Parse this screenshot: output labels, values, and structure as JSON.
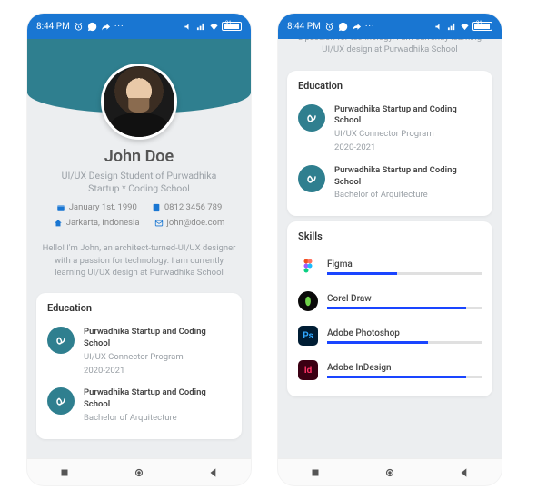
{
  "status": {
    "time": "8:44 PM",
    "icons_left": [
      "alarm-icon",
      "whatsapp-icon",
      "share-icon"
    ],
    "more": "···",
    "icons_right": [
      "voice-icon",
      "signal-icon",
      "wifi-icon"
    ],
    "battery": "91"
  },
  "profile": {
    "name": "John Doe",
    "subtitle": "UI/UX Design Student of Purwadhika Startup * Coding School",
    "birthdate": "January 1st, 1990",
    "phone": "0812 3456 789",
    "location": "Jarkarta, Indonesia",
    "email": "john@doe.com",
    "bio": "Hello! I'm John, an architect-turned-UI/UX designer with a passion for technology. I am currently learning UI/UX design at Purwadhika School",
    "bio_tail": "a passion for technology. I am currently learning UI/UX design at Purwadhika School"
  },
  "education": {
    "title": "Education",
    "items": [
      {
        "school": "Purwadhika Startup and Coding School",
        "program": "UI/UX Connector Program",
        "period": "2020-2021"
      },
      {
        "school": "Purwadhika Startup and Coding School",
        "program": "Bachelor of Arquitecture",
        "period": ""
      }
    ]
  },
  "skills": {
    "title": "Skills",
    "items": [
      {
        "name": "Figma",
        "progress": 45,
        "bg": "#fff",
        "fg": "#f24e1e",
        "label": "F"
      },
      {
        "name": "Corel Draw",
        "progress": 90,
        "bg": "#0a0a0a",
        "fg": "#6fd24a",
        "label": "●"
      },
      {
        "name": "Adobe Photoshop",
        "progress": 65,
        "bg": "#001d34",
        "fg": "#31a8ff",
        "label": "Ps"
      },
      {
        "name": "Adobe InDesign",
        "progress": 90,
        "bg": "#3b0013",
        "fg": "#ff3366",
        "label": "Id"
      }
    ]
  },
  "nav": {
    "items": [
      "recents",
      "home",
      "back"
    ]
  }
}
